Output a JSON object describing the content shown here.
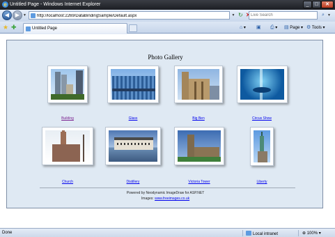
{
  "window": {
    "title": "Untitled Page - Windows Internet Explorer"
  },
  "address": {
    "url": "http://localhost:2269/DataBindingSample/Default.aspx"
  },
  "search": {
    "placeholder": "Live Search"
  },
  "tabs": [
    {
      "label": "Untitled Page"
    }
  ],
  "commands": {
    "page": "Page",
    "tools": "Tools"
  },
  "gallery": {
    "title": "Photo Gallery",
    "items": [
      {
        "caption": "Building",
        "visited": true
      },
      {
        "caption": "Glass",
        "visited": false
      },
      {
        "caption": "Big Ben",
        "visited": false
      },
      {
        "caption": "Circus Show",
        "visited": false
      },
      {
        "caption": "Church",
        "visited": false
      },
      {
        "caption": "Distillery",
        "visited": false
      },
      {
        "caption": "Victoria Tower",
        "visited": false
      },
      {
        "caption": "Liberty",
        "visited": false
      }
    ],
    "footer_line1": "Powered by Neodynamic ImageDraw for ASP.NET",
    "footer_line2_prefix": "Images:",
    "footer_link": "www.freeimages.co.uk"
  },
  "status": {
    "text": "Done",
    "zone": "Local intranet",
    "zoom": "100%"
  },
  "colors": {
    "link": "#0000ee",
    "visited_link": "#7a1f8f",
    "panel_bg": "#dfe9f3"
  }
}
